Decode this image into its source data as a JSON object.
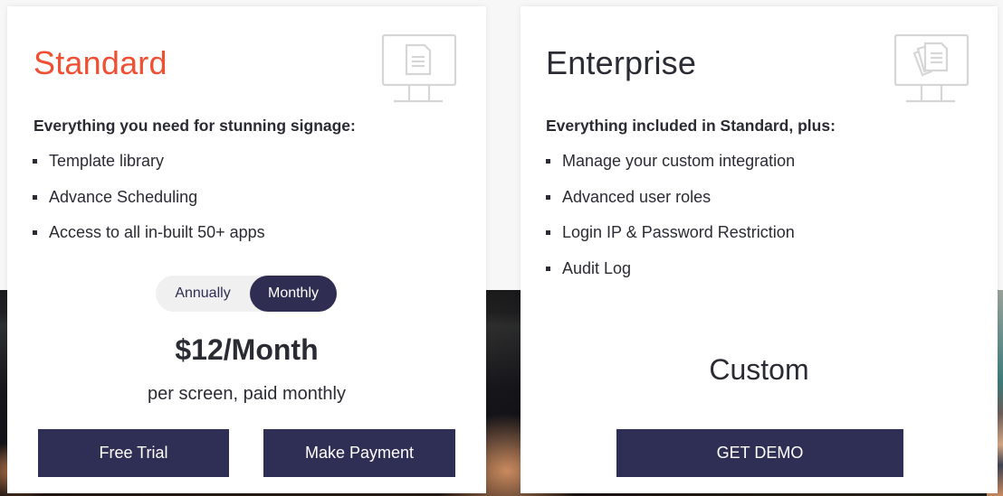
{
  "colors": {
    "accent": "#ef5034",
    "primary_button": "#2f2f55",
    "text": "#2b2b33",
    "toggle_bg": "#f0f0f0",
    "icon_stroke": "#d6d6d6"
  },
  "plans": [
    {
      "title": "Standard",
      "icon": "monitor-document-icon",
      "subtitle": "Everything you need for stunning signage:",
      "features": [
        "Template library",
        "Advance Scheduling",
        "Access to all in-built 50+ apps"
      ],
      "billing_toggle": {
        "options": [
          "Annually",
          "Monthly"
        ],
        "selected": "Monthly"
      },
      "price": "$12/Month",
      "price_note": "per screen, paid monthly",
      "buttons": [
        "Free Trial",
        "Make Payment"
      ]
    },
    {
      "title": "Enterprise",
      "icon": "monitor-documents-stack-icon",
      "subtitle": "Everything included in Standard, plus:",
      "features": [
        "Manage your custom integration",
        "Advanced user roles",
        "Login IP & Password Restriction",
        "Audit Log"
      ],
      "price": "Custom",
      "buttons": [
        "GET DEMO"
      ]
    }
  ]
}
